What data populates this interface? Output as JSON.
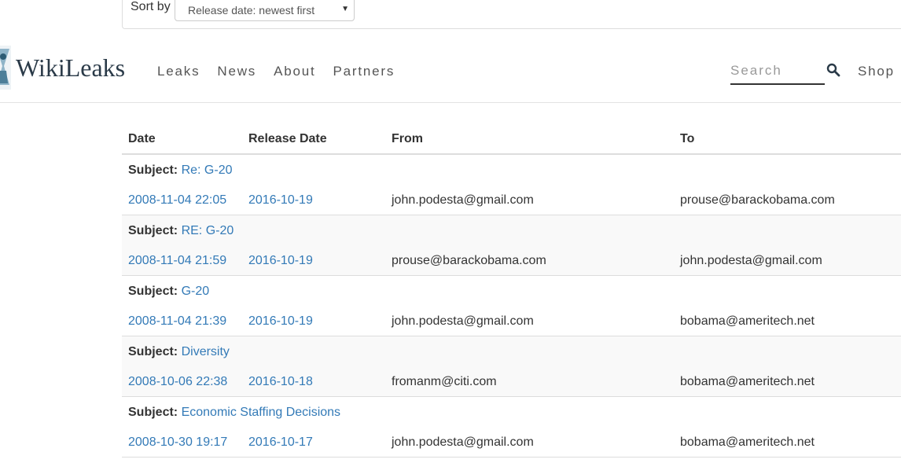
{
  "sort": {
    "label": "Sort by",
    "selected": "Release date: newest first"
  },
  "brand": {
    "name": "WikiLeaks"
  },
  "nav": {
    "items": [
      "Leaks",
      "News",
      "About",
      "Partners"
    ],
    "shop": "Shop"
  },
  "search": {
    "placeholder": "Search"
  },
  "table": {
    "headers": [
      "Date",
      "Release Date",
      "From",
      "To"
    ],
    "subject_label": "Subject:",
    "rows": [
      {
        "subject": "Re: G-20",
        "date": "2008-11-04 22:05",
        "release": "2016-10-19",
        "from": "john.podesta@gmail.com",
        "to": "prouse@barackobama.com"
      },
      {
        "subject": "RE: G-20",
        "date": "2008-11-04 21:59",
        "release": "2016-10-19",
        "from": "prouse@barackobama.com",
        "to": "john.podesta@gmail.com"
      },
      {
        "subject": "G-20",
        "date": "2008-11-04 21:39",
        "release": "2016-10-19",
        "from": "john.podesta@gmail.com",
        "to": "bobama@ameritech.net"
      },
      {
        "subject": "Diversity",
        "date": "2008-10-06 22:38",
        "release": "2016-10-18",
        "from": "fromanm@citi.com",
        "to": "bobama@ameritech.net"
      },
      {
        "subject": "Economic Staffing Decisions",
        "date": "2008-10-30 19:17",
        "release": "2016-10-17",
        "from": "john.podesta@gmail.com",
        "to": "bobama@ameritech.net"
      }
    ]
  },
  "colors": {
    "link": "#337ab7",
    "text": "#333333",
    "alt_row": "#f9f9f9"
  }
}
